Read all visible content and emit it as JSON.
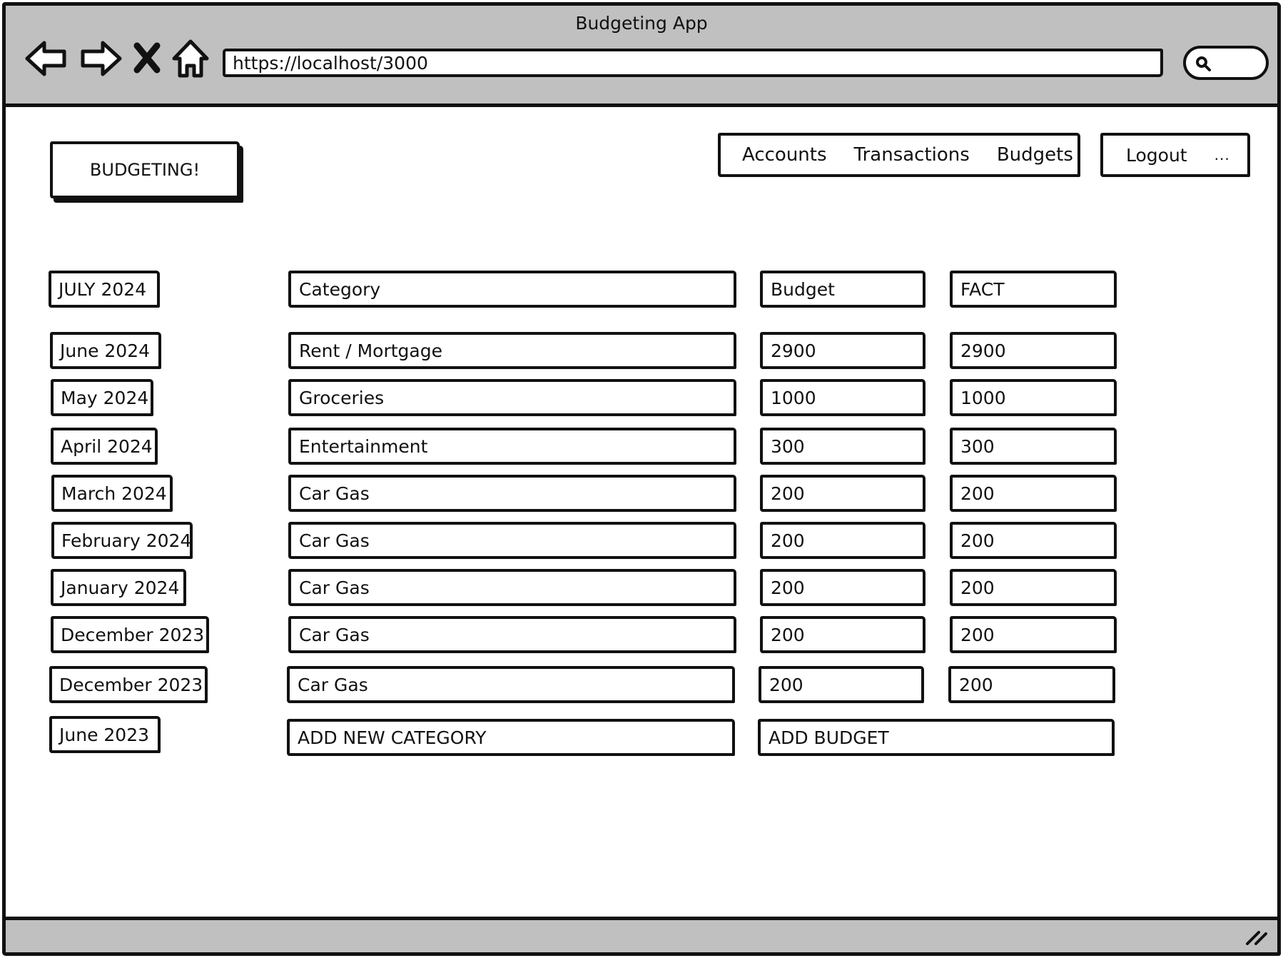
{
  "window": {
    "title": "Budgeting App",
    "url": "https://localhost/3000"
  },
  "header": {
    "brand": "BUDGETING!",
    "nav": [
      "Accounts",
      "Transactions",
      "Budgets"
    ],
    "logout": "Logout",
    "more": "..."
  },
  "months": [
    "JULY 2024",
    "June 2024",
    "May 2024",
    "April 2024",
    "March 2024",
    "February 2024",
    "January 2024",
    "December 2023",
    "December 2023",
    "June 2023"
  ],
  "table": {
    "headers": [
      "Category",
      "Budget",
      "FACT"
    ],
    "rows": [
      [
        "Rent / Mortgage",
        "2900",
        "2900"
      ],
      [
        "Groceries",
        "1000",
        "1000"
      ],
      [
        "Entertainment",
        "300",
        "300"
      ],
      [
        "Car Gas",
        "200",
        "200"
      ],
      [
        "Car Gas",
        "200",
        "200"
      ],
      [
        "Car Gas",
        "200",
        "200"
      ],
      [
        "Car Gas",
        "200",
        "200"
      ],
      [
        "Car Gas",
        "200",
        "200"
      ]
    ],
    "add_category": "ADD NEW CATEGORY",
    "add_budget": "ADD BUDGET"
  },
  "icons": {
    "back": "back-arrow-icon",
    "forward": "forward-arrow-icon",
    "stop": "close-icon",
    "home": "home-icon",
    "search": "search-icon",
    "resize": "resize-grip-icon"
  },
  "colors": {
    "chrome": "#c0c0c0",
    "ink": "#111111",
    "background": "#ffffff"
  }
}
